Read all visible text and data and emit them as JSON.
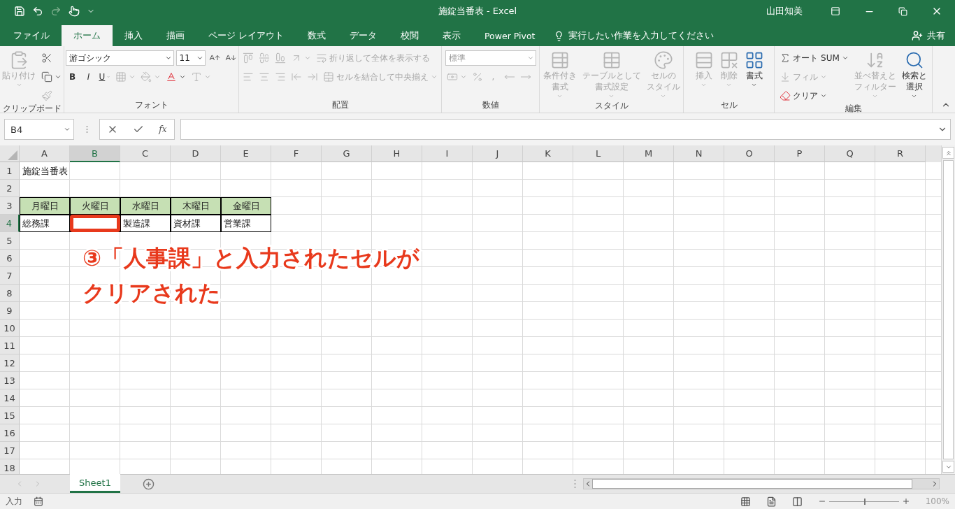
{
  "title_bar": {
    "title": "施錠当番表 - Excel",
    "user": "山田知美"
  },
  "tabs": [
    {
      "label": "ファイル",
      "selected": false
    },
    {
      "label": "ホーム",
      "selected": true
    },
    {
      "label": "挿入",
      "selected": false
    },
    {
      "label": "描画",
      "selected": false
    },
    {
      "label": "ページ レイアウト",
      "selected": false
    },
    {
      "label": "数式",
      "selected": false
    },
    {
      "label": "データ",
      "selected": false
    },
    {
      "label": "校閲",
      "selected": false
    },
    {
      "label": "表示",
      "selected": false
    },
    {
      "label": "Power Pivot",
      "selected": false
    }
  ],
  "tell_me": {
    "placeholder": "実行したい作業を入力してください"
  },
  "share": {
    "label": "共有"
  },
  "ribbon": [
    {
      "label": "クリップボード",
      "columns": [
        {
          "kind": "large",
          "items": [
            {
              "kind": "paste",
              "lines": [
                "貼り付け"
              ],
              "disabled": true,
              "dropdown": true
            }
          ]
        },
        {
          "kind": "stack",
          "rows": [
            {
              "items": [
                {
                  "kind": "cut",
                  "disabled": false,
                  "dropdown": false
                }
              ]
            },
            {
              "items": [
                {
                  "kind": "copy",
                  "disabled": false,
                  "dropdown": true
                }
              ]
            },
            {
              "items": [
                {
                  "kind": "painter",
                  "disabled": true,
                  "dropdown": false
                }
              ]
            }
          ]
        }
      ]
    },
    {
      "label": "フォント",
      "columns": [
        {
          "kind": "stack",
          "rows": [
            {
              "items": [
                {
                  "kind": "font-field",
                  "value": "游ゴシック",
                  "disabled": false,
                  "dropdown": true
                },
                {
                  "kind": "size-field",
                  "value": "11",
                  "disabled": false,
                  "dropdown": true
                },
                {
                  "kind": "grow",
                  "disabled": false,
                  "dropdown": false
                },
                {
                  "kind": "shrink",
                  "disabled": false,
                  "dropdown": false
                }
              ]
            },
            {
              "items": [
                {
                  "kind": "letter-bold",
                  "label": "B",
                  "disabled": false,
                  "dropdown": false
                },
                {
                  "kind": "letter-italic",
                  "label": "I",
                  "disabled": false,
                  "dropdown": false
                },
                {
                  "kind": "letter-underline",
                  "label": "U",
                  "disabled": false,
                  "dropdown": true
                },
                {
                  "kind": "borders",
                  "disabled": true,
                  "dropdown": true
                },
                {
                  "kind": "fill",
                  "disabled": true,
                  "dropdown": true
                },
                {
                  "kind": "font-color",
                  "disabled": false,
                  "dropdown": true
                },
                {
                  "kind": "phonetic",
                  "disabled": true,
                  "dropdown": true
                }
              ]
            }
          ]
        }
      ]
    },
    {
      "label": "配置",
      "columns": [
        {
          "kind": "stack",
          "rows": [
            {
              "items": [
                {
                  "kind": "align-top",
                  "disabled": true,
                  "dropdown": false
                },
                {
                  "kind": "align-middle",
                  "disabled": true,
                  "dropdown": false
                },
                {
                  "kind": "align-bottom",
                  "disabled": true,
                  "dropdown": false
                },
                {
                  "kind": "orientation",
                  "disabled": true,
                  "dropdown": true
                },
                {
                  "kind": "wrap",
                  "label": "折り返して全体を表示する",
                  "disabled": true,
                  "dropdown": false
                }
              ]
            },
            {
              "items": [
                {
                  "kind": "align-left",
                  "disabled": true,
                  "dropdown": false
                },
                {
                  "kind": "align-center",
                  "disabled": true,
                  "dropdown": false
                },
                {
                  "kind": "align-right",
                  "disabled": true,
                  "dropdown": false
                },
                {
                  "kind": "outdent",
                  "disabled": true,
                  "dropdown": false
                },
                {
                  "kind": "indent",
                  "disabled": true,
                  "dropdown": false
                },
                {
                  "kind": "merge",
                  "label": "セルを結合して中央揃え",
                  "disabled": true,
                  "dropdown": true
                }
              ]
            }
          ]
        }
      ]
    },
    {
      "label": "数値",
      "columns": [
        {
          "kind": "stack",
          "rows": [
            {
              "items": [
                {
                  "kind": "format-field",
                  "value": "標準",
                  "disabled": true,
                  "dropdown": true
                }
              ]
            },
            {
              "items": [
                {
                  "kind": "currency",
                  "disabled": true,
                  "dropdown": true
                },
                {
                  "kind": "percent",
                  "disabled": true,
                  "dropdown": false
                },
                {
                  "kind": "letter",
                  "label": ",",
                  "disabled": true,
                  "dropdown": false
                },
                {
                  "kind": "decimal-more",
                  "disabled": true,
                  "dropdown": false
                },
                {
                  "kind": "decimal-less",
                  "disabled": true,
                  "dropdown": false
                }
              ]
            }
          ]
        }
      ]
    },
    {
      "label": "スタイル",
      "columns": [
        {
          "kind": "large",
          "items": [
            {
              "kind": "conditional",
              "lines": [
                "条件付き",
                "書式"
              ],
              "disabled": true,
              "dropdown": true
            },
            {
              "kind": "table-format",
              "lines": [
                "テーブルとして",
                "書式設定"
              ],
              "disabled": true,
              "dropdown": true
            },
            {
              "kind": "cell-styles",
              "lines": [
                "セルの",
                "スタイル"
              ],
              "disabled": true,
              "dropdown": true
            }
          ]
        }
      ]
    },
    {
      "label": "セル",
      "columns": [
        {
          "kind": "large",
          "items": [
            {
              "kind": "insert",
              "lines": [
                "挿入"
              ],
              "disabled": true,
              "dropdown": true
            },
            {
              "kind": "delete",
              "lines": [
                "削除"
              ],
              "disabled": true,
              "dropdown": true
            },
            {
              "kind": "format",
              "lines": [
                "書式"
              ],
              "disabled": false,
              "dropdown": true
            }
          ]
        }
      ]
    },
    {
      "label": "編集",
      "columns": [
        {
          "kind": "stack",
          "rows": [
            {
              "items": [
                {
                  "kind": "autosum",
                  "label": "オート SUM",
                  "disabled": false,
                  "dropdown": true
                }
              ]
            },
            {
              "items": [
                {
                  "kind": "fill-down",
                  "label": "フィル",
                  "disabled": true,
                  "dropdown": true
                }
              ]
            },
            {
              "items": [
                {
                  "kind": "clear",
                  "label": "クリア",
                  "disabled": false,
                  "dropdown": true
                }
              ]
            }
          ]
        },
        {
          "kind": "large",
          "items": [
            {
              "kind": "sort",
              "lines": [
                "並べ替えと",
                "フィルター"
              ],
              "disabled": true,
              "dropdown": true
            },
            {
              "kind": "find",
              "lines": [
                "検索と",
                "選択"
              ],
              "disabled": false,
              "dropdown": true
            }
          ]
        }
      ]
    }
  ],
  "formula_bar": {
    "name_box": "B4",
    "fx": "fx"
  },
  "sheet": {
    "columns": [
      {
        "label": "A",
        "selected": false
      },
      {
        "label": "B",
        "selected": true
      },
      {
        "label": "C",
        "selected": false
      },
      {
        "label": "D",
        "selected": false
      },
      {
        "label": "E",
        "selected": false
      },
      {
        "label": "F",
        "selected": false
      },
      {
        "label": "G",
        "selected": false
      },
      {
        "label": "H",
        "selected": false
      },
      {
        "label": "I",
        "selected": false
      },
      {
        "label": "J",
        "selected": false
      },
      {
        "label": "K",
        "selected": false
      },
      {
        "label": "L",
        "selected": false
      },
      {
        "label": "M",
        "selected": false
      },
      {
        "label": "N",
        "selected": false
      },
      {
        "label": "O",
        "selected": false
      },
      {
        "label": "P",
        "selected": false
      },
      {
        "label": "Q",
        "selected": false
      },
      {
        "label": "R",
        "selected": false
      }
    ],
    "rows": [
      {
        "label": "1",
        "selected": false,
        "cells": [
          {
            "kind": "title",
            "text": "施錠当番表",
            "selected": false
          }
        ]
      },
      {
        "label": "2",
        "selected": false
      },
      {
        "label": "3",
        "selected": false,
        "cells": [
          {
            "kind": "heading",
            "text": "月曜日",
            "selected": false
          },
          {
            "kind": "heading",
            "text": "火曜日",
            "selected": false
          },
          {
            "kind": "heading",
            "text": "水曜日",
            "selected": false
          },
          {
            "kind": "heading",
            "text": "木曜日",
            "selected": false
          },
          {
            "kind": "heading",
            "text": "金曜日",
            "selected": false
          }
        ]
      },
      {
        "label": "4",
        "selected": true,
        "cells": [
          {
            "kind": "entry",
            "text": "総務課",
            "selected": false
          },
          {
            "kind": "entry",
            "selected": true
          },
          {
            "kind": "entry",
            "text": "製造課",
            "selected": false
          },
          {
            "kind": "entry",
            "text": "資材課",
            "selected": false
          },
          {
            "kind": "entry",
            "text": "営業課",
            "selected": false
          }
        ]
      },
      {
        "label": "5",
        "selected": false
      },
      {
        "label": "6",
        "selected": false
      },
      {
        "label": "7",
        "selected": false
      },
      {
        "label": "8",
        "selected": false
      },
      {
        "label": "9",
        "selected": false
      },
      {
        "label": "10",
        "selected": false
      },
      {
        "label": "11",
        "selected": false
      },
      {
        "label": "12",
        "selected": false
      },
      {
        "label": "13",
        "selected": false
      },
      {
        "label": "14",
        "selected": false
      },
      {
        "label": "15",
        "selected": false
      },
      {
        "label": "16",
        "selected": false
      },
      {
        "label": "17",
        "selected": false
      },
      {
        "label": "18",
        "selected": false
      }
    ]
  },
  "annotation": {
    "lines": [
      "③「人事課」と入力されたセルが",
      "クリアされた"
    ]
  },
  "sheet_tabs": [
    {
      "label": "Sheet1",
      "selected": true
    }
  ],
  "status_bar": {
    "mode": "入力",
    "zoom": "100%",
    "zoom_slider": {
      "level": 0.5
    }
  }
}
